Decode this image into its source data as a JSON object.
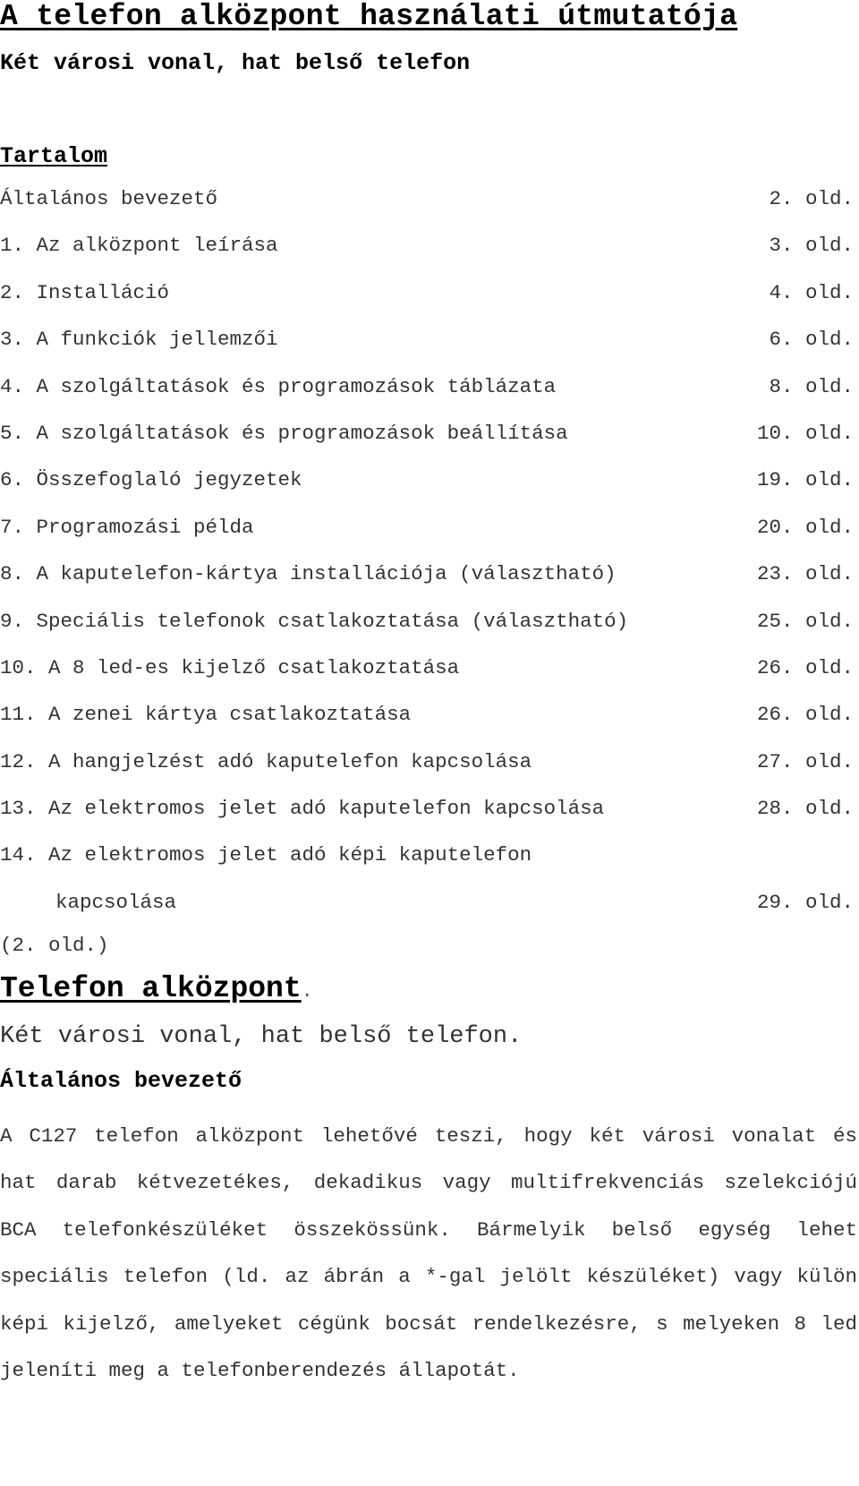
{
  "document": {
    "title": "A telefon alközpont használati útmutatója",
    "subtitle": "Két városi vonal, hat belső telefon",
    "toc": {
      "heading": "Tartalom",
      "entries": [
        {
          "label": "Általános bevezető",
          "page": "2. old."
        },
        {
          "label": "1. Az alközpont leírása",
          "page": "3. old."
        },
        {
          "label": "2. Installáció",
          "page": "4. old."
        },
        {
          "label": "3. A funkciók jellemzői",
          "page": "6. old."
        },
        {
          "label": "4. A szolgáltatások és programozások táblázata",
          "page": "8. old."
        },
        {
          "label": "5. A szolgáltatások és programozások beállítása",
          "page": "10. old."
        },
        {
          "label": "6. Összefoglaló jegyzetek",
          "page": "19. old."
        },
        {
          "label": "7. Programozási példa",
          "page": "20. old."
        },
        {
          "label": "8. A kaputelefon-kártya installációja (választható)",
          "page": "23. old."
        },
        {
          "label": "9. Speciális telefonok csatlakoztatása (választható)",
          "page": "25. old."
        },
        {
          "label": "10. A 8 led-es kijelző csatlakoztatása",
          "page": "26. old."
        },
        {
          "label": "11. A zenei kártya csatlakoztatása",
          "page": "26. old."
        },
        {
          "label": "12. A hangjelzést adó kaputelefon kapcsolása",
          "page": "27. old."
        },
        {
          "label": "13. Az elektromos jelet adó kaputelefon kapcsolása",
          "page": "28. old."
        },
        {
          "label": "14. Az elektromos jelet adó képi kaputelefon",
          "page": ""
        },
        {
          "label": "kapcsolása",
          "page": "29. old."
        }
      ]
    },
    "page_marker": "(2. old.)",
    "section": {
      "title": "Telefon alközpont",
      "title_suffix": ".",
      "subtitle": "Két városi vonal, hat belső telefon.",
      "intro_heading": "Általános bevezető",
      "paragraph": "A C127 telefon alközpont lehetővé teszi, hogy két városi vonalat és hat darab kétvezetékes, dekadikus vagy multifrekvenciás szelekciójú BCA telefonkészüléket összekössünk. Bármelyik belső egység lehet speciális telefon (ld. az ábrán a *-gal jelölt készüléket) vagy külön képi kijelző, amelyeket cégünk bocsát rendelkezésre, s melyeken 8 led jeleníti meg a telefonberendezés állapotát."
    }
  }
}
